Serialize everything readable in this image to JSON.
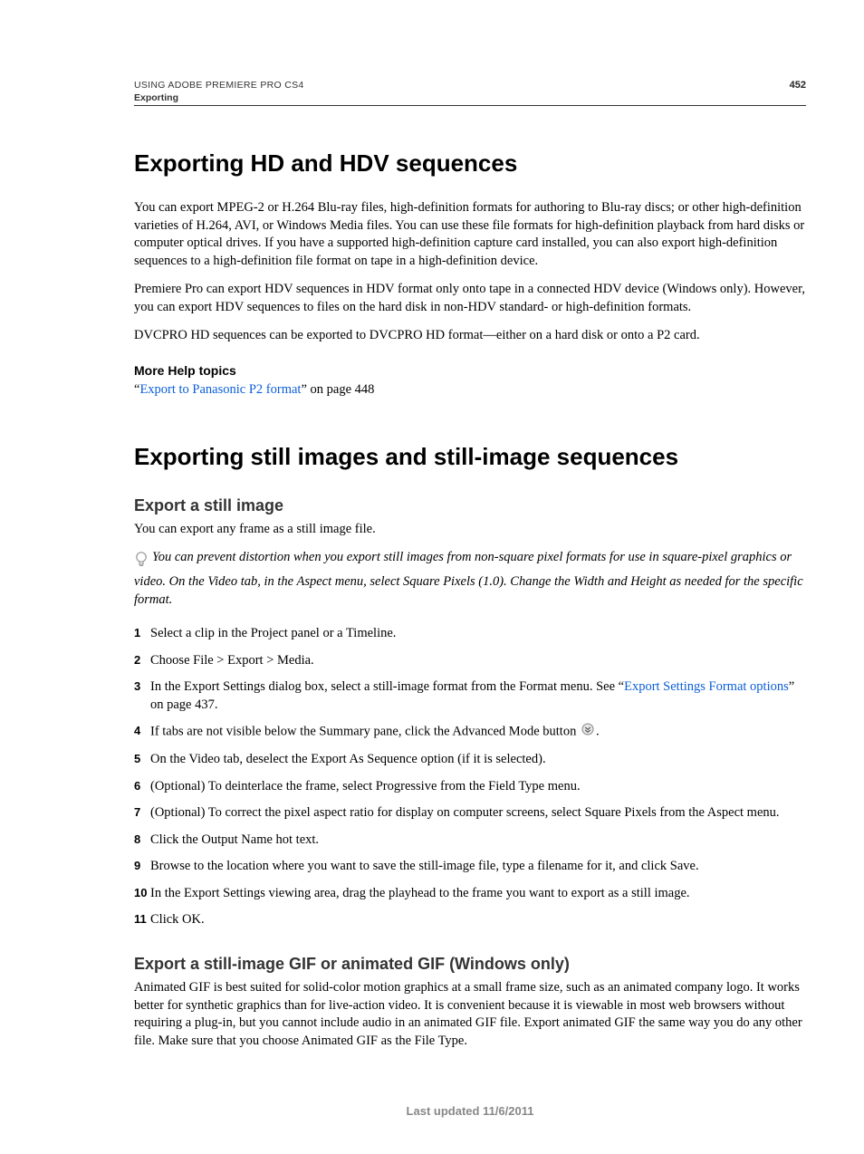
{
  "header": {
    "product": "USING ADOBE PREMIERE PRO CS4",
    "chapter": "Exporting",
    "page": "452"
  },
  "section1": {
    "title": "Exporting HD and HDV sequences",
    "p1": "You can export MPEG-2 or H.264 Blu-ray files, high-definition formats for authoring to Blu-ray discs; or other high-definition varieties of H.264, AVI, or Windows Media files. You can use these file formats for high-definition playback from hard disks or computer optical drives. If you have a supported high-definition capture card installed, you can also export high-definition sequences to a high-definition file format on tape in a high-definition device.",
    "p2": "Premiere Pro can export HDV sequences in HDV format only onto tape in a connected HDV device (Windows only). However, you can export HDV sequences to files on the hard disk in non-HDV standard- or high-definition formats.",
    "p3": "DVCPRO HD sequences can be exported to DVCPRO HD format—either on a hard disk or onto a P2 card.",
    "help_label": "More Help topics",
    "help_quote_open": "“",
    "help_link": "Export to Panasonic P2 format",
    "help_tail": "” on page 448"
  },
  "section2": {
    "title": "Exporting still images and still-image sequences",
    "sub1_title": "Export a still image",
    "sub1_p1": "You can export any frame as a still image file.",
    "tip": "You can prevent distortion when you export still images from non-square pixel formats for use in square-pixel graphics or video. On the Video tab, in the Aspect menu, select Square Pixels (1.0). Change the Width and Height as needed for the specific format.",
    "steps": [
      {
        "text_a": "Select a clip in the Project panel or a Timeline."
      },
      {
        "text_a": "Choose File > Export > Media."
      },
      {
        "text_a": "In the Export Settings dialog box, select a still-image format from the Format menu. See “",
        "link": "Export Settings Format options",
        "text_b": "” on page 437."
      },
      {
        "text_a": "If tabs are not visible below the Summary pane, click the Advanced Mode button ",
        "icon": "advanced-mode-icon",
        "text_b": "."
      },
      {
        "text_a": "On the Video tab, deselect the Export As Sequence option (if it is selected)."
      },
      {
        "text_a": "(Optional) To deinterlace the frame, select Progressive from the Field Type menu."
      },
      {
        "text_a": "(Optional) To correct the pixel aspect ratio for display on computer screens, select Square Pixels from the Aspect menu."
      },
      {
        "text_a": "Click the Output Name hot text."
      },
      {
        "text_a": "Browse to the location where you want to save the still-image file, type a filename for it, and click Save."
      },
      {
        "text_a": "In the Export Settings viewing area, drag the playhead to the frame you want to export as a still image."
      },
      {
        "text_a": "Click OK."
      }
    ],
    "sub2_title": "Export a still-image GIF or animated GIF (Windows only)",
    "sub2_p1": "Animated GIF is best suited for solid-color motion graphics at a small frame size, such as an animated company logo. It works better for synthetic graphics than for live-action video. It is convenient because it is viewable in most web browsers without requiring a plug-in, but you cannot include audio in an animated GIF file. Export animated GIF the same way you do any other file. Make sure that you choose Animated GIF as the File Type."
  },
  "footer": "Last updated 11/6/2011"
}
